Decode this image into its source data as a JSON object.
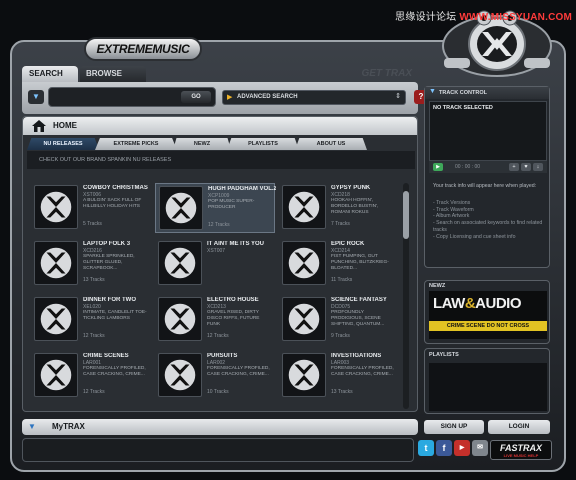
{
  "watermark": {
    "part1": "思缘设计论坛 ",
    "part2": "WWW.MISSYUAN.COM"
  },
  "brand": {
    "logo": "EXTREMEMUSIC"
  },
  "top_tabs": {
    "search": "SEARCH",
    "browse": "BROWSE",
    "get_trax": "GET TRAX"
  },
  "search": {
    "go": "GO",
    "advanced": "ADVANCED SEARCH",
    "help": "?"
  },
  "home": {
    "title": "HOME",
    "tabs": [
      "NU RELEASES",
      "EXTREME PICKS",
      "NEWZ",
      "PLAYLISTS",
      "ABOUT US"
    ],
    "subhead": "CHECK OUT OUR BRAND SPANKIN NU RELEASES",
    "cards": [
      {
        "title": "COWBOY CHRISTMAS",
        "code": "XST006",
        "desc": "A BULGIN' SACK FULL OF HILLBILLY HOLIDAY HITS",
        "tracks": "5 Tracks"
      },
      {
        "title": "HUGH PADGHAM VOL.2",
        "code": "XCP1009",
        "desc": "POP MUSIC SUPER-PRODUCER",
        "tracks": "12 Tracks"
      },
      {
        "title": "GYPSY PUNK",
        "code": "XCD218",
        "desc": "HOOKAH HOFFIN', BORDELLO BUSTIN', ROMANI ROKUS",
        "tracks": "7 Tracks"
      },
      {
        "title": "LAPTOP FOLK 3",
        "code": "XCD216",
        "desc": "SPARKLE SPRINKLED, GLITTER GLUED, SCRAPBOOK...",
        "tracks": "13 Tracks"
      },
      {
        "title": "IT AINT ME ITS YOU",
        "code": "XST007",
        "desc": "",
        "tracks": ""
      },
      {
        "title": "EPIC ROCK",
        "code": "XCD214",
        "desc": "FIST PUMPING, GUT PUNCHING, BLITZKRIEG-BLOATED...",
        "tracks": "11 Tracks"
      },
      {
        "title": "DINNER FOR TWO",
        "code": "XEL020",
        "desc": "INTIMATE, CANDLELIT TOE-TICKLING LAMBORS",
        "tracks": "12 Tracks"
      },
      {
        "title": "ELECTRO HOUSE",
        "code": "XCD213",
        "desc": "GRAVEL RISED, DIRTY DISCO RIFFS, FUTURE FUNK",
        "tracks": "12 Tracks"
      },
      {
        "title": "SCIENCE FANTASY",
        "code": "DCD075",
        "desc": "PROFOUNDLY PRODIGIOUS, SCENE SHIFTING, QUANTUM...",
        "tracks": "9 Tracks"
      },
      {
        "title": "CRIME SCENES",
        "code": "LAR001",
        "desc": "FORENSICALLY PROFILED, CASE CRACKING, CRIME...",
        "tracks": "12 Tracks"
      },
      {
        "title": "PURSUITS",
        "code": "LAR002",
        "desc": "FORENSICALLY PROFILED, CASE CRACKING, CRIME...",
        "tracks": "10 Tracks"
      },
      {
        "title": "INVESTIGATIONS",
        "code": "LAR003",
        "desc": "FORENSICALLY PROFILED, CASE CRACKING, CRIME...",
        "tracks": "13 Tracks"
      }
    ]
  },
  "mytrax": {
    "label": "MyTRAX"
  },
  "track_control": {
    "title": "TRACK CONTROL",
    "now": "NO TRACK SELECTED",
    "time": "00 : 00 : 00",
    "intro": "Your track info will appear here when played:",
    "items": [
      "- Track Versions",
      "- Track Waveform",
      "- Album Artwork",
      "- Search on associated keywords to find related tracks",
      "- Copy Licensing and cue sheet info"
    ]
  },
  "newz": {
    "label": "NEWZ",
    "ad_title_1": "LAW",
    "ad_title_amp": "&",
    "ad_title_2": "AUDIO",
    "ad_tape": "CRIME SCENE DO NOT CROSS"
  },
  "playlists": {
    "label": "PLAYLISTS"
  },
  "auth": {
    "signup": "SIGN UP",
    "login": "LOGIN"
  },
  "fastrax": {
    "title": "FASTRAX",
    "subtitle": "LIVE MUSIC HELP"
  },
  "colors": {
    "accent_blue": "#2d74c0",
    "play_green": "#3ea85a",
    "help_red": "#9b1d1d",
    "tape_yellow": "#e2c323"
  }
}
